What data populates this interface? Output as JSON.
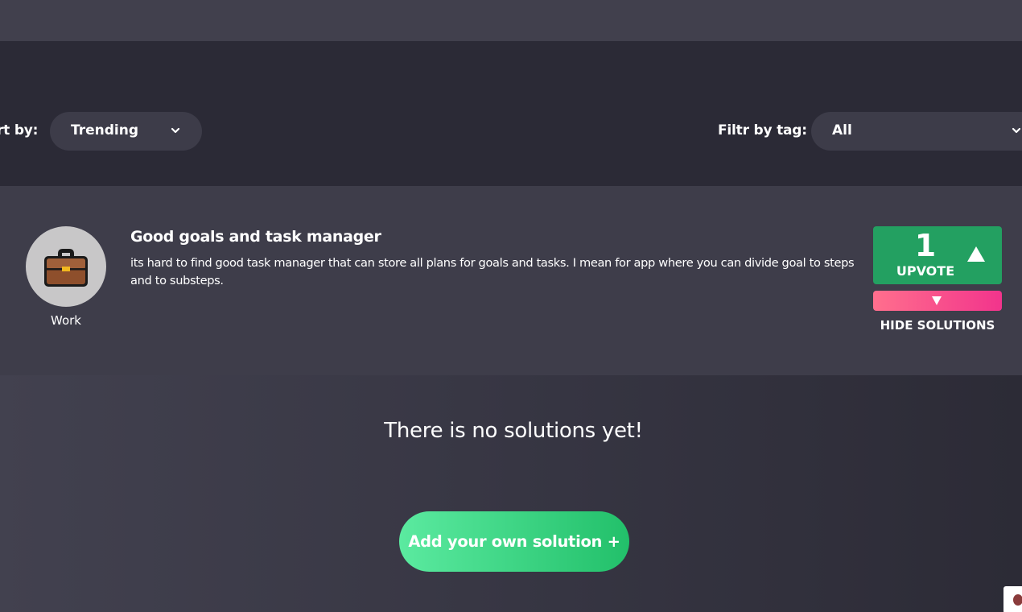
{
  "filters": {
    "sort_label": "rt by:",
    "sort_value": "Trending",
    "tag_label": "Filtr by tag:",
    "tag_value": "All"
  },
  "problem": {
    "tag": "Work",
    "tag_icon": "briefcase-icon",
    "title": "Good goals and task manager",
    "description": "its hard to find good task manager that can store all plans for goals and tasks. I mean for app where you can divide goal to steps and to substeps.",
    "upvotes": "1",
    "upvote_label": "UPVOTE",
    "hide_solutions_label": "HIDE SOLUTIONS"
  },
  "solutions": {
    "empty_message": "There is no solutions yet!",
    "add_button_label": "Add your own solution +"
  },
  "colors": {
    "upvote": "#23a061",
    "downvote_start": "#ff6f8d",
    "downvote_end": "#f2348c",
    "add_button_start": "#5beaa0",
    "add_button_end": "#22c06a"
  }
}
